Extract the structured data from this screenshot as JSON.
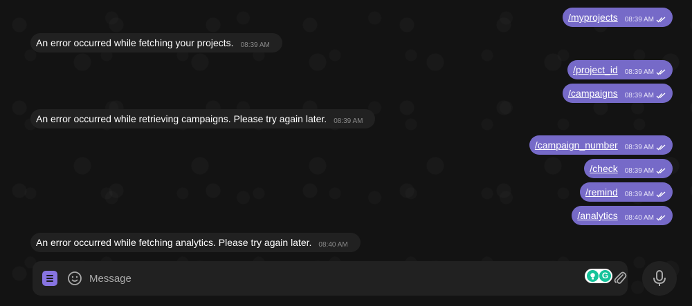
{
  "messages": [
    {
      "dir": "out",
      "text": "/myprojects",
      "time": "08:39 AM"
    },
    {
      "dir": "in",
      "text": "An error occurred while fetching your projects.",
      "time": "08:39 AM"
    },
    {
      "dir": "out",
      "text": "/project_id",
      "time": "08:39 AM"
    },
    {
      "dir": "out",
      "text": "/campaigns",
      "time": "08:39 AM"
    },
    {
      "dir": "in",
      "text": "An error occurred while retrieving campaigns. Please try again later.",
      "time": "08:39 AM"
    },
    {
      "dir": "out",
      "text": "/campaign_number",
      "time": "08:39 AM"
    },
    {
      "dir": "out",
      "text": "/check",
      "time": "08:39 AM"
    },
    {
      "dir": "out",
      "text": "/remind",
      "time": "08:39 AM"
    },
    {
      "dir": "out",
      "text": "/analytics",
      "time": "08:40 AM"
    },
    {
      "dir": "in",
      "text": "An error occurred while fetching analytics. Please try again later.",
      "time": "08:40 AM"
    }
  ],
  "composer": {
    "placeholder": "Message",
    "value": "",
    "extension_letter": "G"
  },
  "icons": {
    "menu": "menu-icon",
    "emoji": "smile-icon",
    "extension": "grammarly-icon",
    "attach": "paperclip-icon",
    "mic": "microphone-icon",
    "read_status": "double-check-icon"
  },
  "colors": {
    "background": "#131313",
    "incoming_bubble": "#212121",
    "outgoing_bubble": "#766ac8",
    "accent": "#8774e1"
  }
}
